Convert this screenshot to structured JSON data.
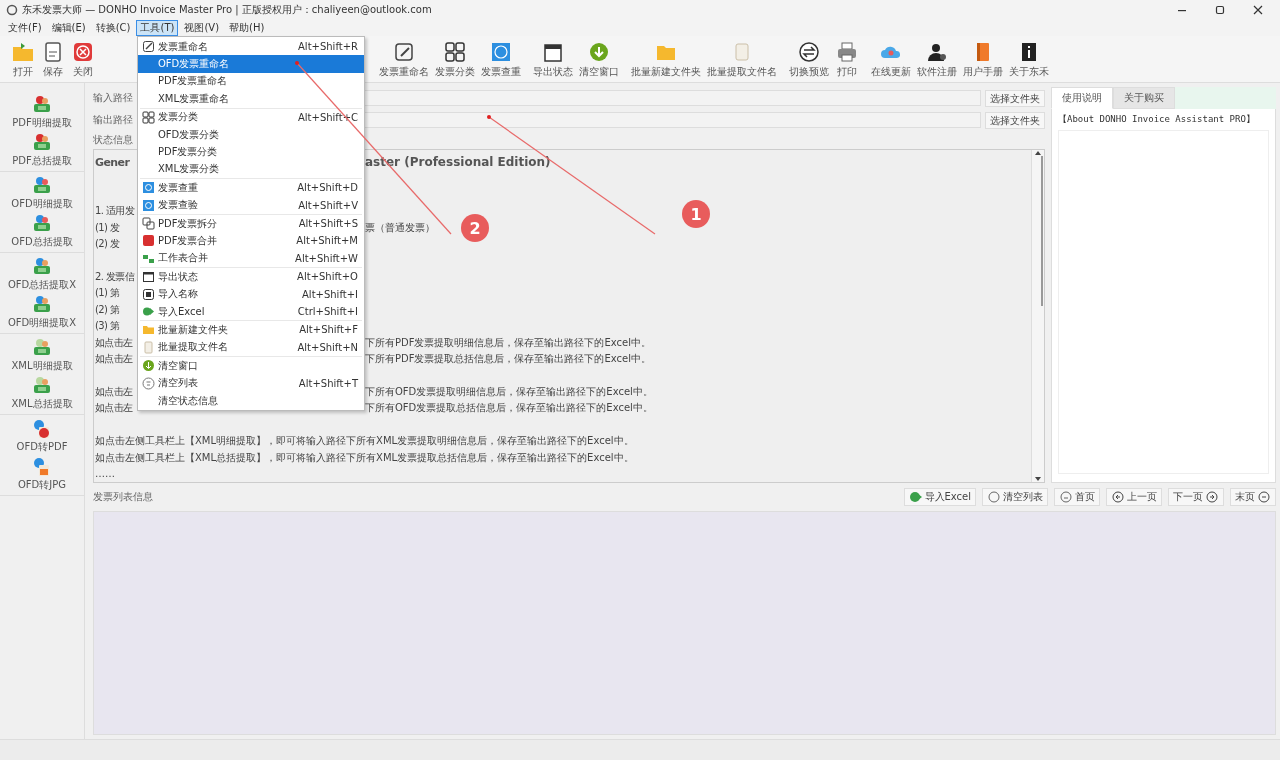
{
  "window": {
    "title": "东禾发票大师 — DONHO Invoice Master Pro  |  正版授权用户：chaliyeen@outlook.com"
  },
  "menu_bar": [
    {
      "label": "文件(F)",
      "selected": false
    },
    {
      "label": "编辑(E)",
      "selected": false
    },
    {
      "label": "转换(C)",
      "selected": false
    },
    {
      "label": "工具(T)",
      "selected": true
    },
    {
      "label": "视图(V)",
      "selected": false
    },
    {
      "label": "帮助(H)",
      "selected": false
    }
  ],
  "toolbar": {
    "groups": [
      [
        "打开",
        "保存",
        "关闭"
      ],
      [
        "发票重命名",
        "发票分类",
        "发票查重"
      ],
      [
        "导出状态",
        "清空窗口"
      ],
      [
        "批量新建文件夹",
        "批量提取文件名"
      ],
      [
        "切换预览",
        "打印"
      ],
      [
        "在线更新",
        "软件注册",
        "用户手册",
        "关于东禾"
      ]
    ]
  },
  "tools_menu": {
    "sections": [
      [
        {
          "label": "发票重命名",
          "shortcut": "Alt+Shift+R",
          "selected": false
        },
        {
          "label": "OFD发票重命名",
          "selected": true
        },
        {
          "label": "PDF发票重命名",
          "selected": false
        },
        {
          "label": "XML发票重命名",
          "selected": false
        }
      ],
      [
        {
          "label": "发票分类",
          "shortcut": "Alt+Shift+C",
          "selected": false
        },
        {
          "label": "OFD发票分类",
          "selected": false
        },
        {
          "label": "PDF发票分类",
          "selected": false
        },
        {
          "label": "XML发票分类",
          "selected": false
        }
      ],
      [
        {
          "label": "发票查重",
          "shortcut": "Alt+Shift+D",
          "selected": false
        },
        {
          "label": "发票查验",
          "shortcut": "Alt+Shift+V",
          "selected": false
        }
      ],
      [
        {
          "label": "PDF发票拆分",
          "shortcut": "Alt+Shift+S",
          "selected": false
        },
        {
          "label": "PDF发票合并",
          "shortcut": "Alt+Shift+M",
          "selected": false
        },
        {
          "label": "工作表合并",
          "shortcut": "Alt+Shift+W",
          "selected": false
        }
      ],
      [
        {
          "label": "导出状态",
          "shortcut": "Alt+Shift+O",
          "selected": false
        },
        {
          "label": "导入名称",
          "shortcut": "Alt+Shift+I",
          "selected": false
        },
        {
          "label": "导入Excel",
          "shortcut": "Ctrl+Shift+I",
          "selected": false
        }
      ],
      [
        {
          "label": "批量新建文件夹",
          "shortcut": "Alt+Shift+F",
          "selected": false
        },
        {
          "label": "批量提取文件名",
          "shortcut": "Alt+Shift+N",
          "selected": false
        }
      ],
      [
        {
          "label": "清空窗口",
          "selected": false
        },
        {
          "label": "清空列表",
          "shortcut": "Alt+Shift+T",
          "selected": false
        },
        {
          "label": "清空状态信息",
          "selected": false
        }
      ]
    ]
  },
  "sidebar": {
    "groups": [
      [
        "PDF明细提取",
        "PDF总括提取"
      ],
      [
        "OFD明细提取",
        "OFD总括提取"
      ],
      [
        "OFD总括提取X",
        "OFD明细提取X"
      ],
      [
        "XML明细提取",
        "XML总括提取"
      ],
      [
        "OFD转PDF",
        "OFD转JPG"
      ]
    ]
  },
  "paths": [
    {
      "label": "输入路径",
      "button": "选择文件夹"
    },
    {
      "label": "输出路径",
      "button": "选择文件夹"
    }
  ],
  "status_label": "状态信息",
  "status_text": [
    {
      "kind": "heading",
      "left": "Gener",
      "right": "aster (Professional Edition)"
    },
    {
      "kind": "blank"
    },
    {
      "kind": "blank"
    },
    {
      "kind": "split",
      "left": "1. 适用发"
    },
    {
      "kind": "split",
      "left": "(1) 发",
      "right": "票（普通发票）"
    },
    {
      "kind": "split",
      "left": "(2) 发"
    },
    {
      "kind": "blank"
    },
    {
      "kind": "split",
      "left": "2. 发票信"
    },
    {
      "kind": "split",
      "left": "(1) 第"
    },
    {
      "kind": "split",
      "left": "(2) 第"
    },
    {
      "kind": "split",
      "left": "(3) 第"
    },
    {
      "kind": "split",
      "left": "如点击左",
      "right": "下所有PDF发票提取明细信息后，保存至输出路径下的Excel中。"
    },
    {
      "kind": "split",
      "left": "如点击左",
      "right": "下所有PDF发票提取总括信息后，保存至输出路径下的Excel中。"
    },
    {
      "kind": "blank"
    },
    {
      "kind": "split",
      "left": "如点击左",
      "right": "下所有OFD发票提取明细信息后，保存至输出路径下的Excel中。"
    },
    {
      "kind": "split",
      "left": "如点击左",
      "right": "下所有OFD发票提取总括信息后，保存至输出路径下的Excel中。"
    },
    {
      "kind": "blank"
    },
    {
      "kind": "full",
      "text": "如点击左侧工具栏上【XML明细提取】，即可将输入路径下所有XML发票提取明细信息后，保存至输出路径下的Excel中。"
    },
    {
      "kind": "full",
      "text": "如点击左侧工具栏上【XML总括提取】，即可将输入路径下所有XML发票提取总括信息后，保存至输出路径下的Excel中。"
    },
    {
      "kind": "full",
      "text": "……"
    }
  ],
  "side_tabs": [
    {
      "label": "使用说明",
      "selected": true
    },
    {
      "label": "关于购买",
      "selected": false
    }
  ],
  "about_text": "【About DONHO Invoice Assistant PRO】",
  "list": {
    "title": "发票列表信息",
    "buttons": [
      "导入Excel",
      "清空列表",
      "首页",
      "上一页",
      "下一页",
      "末页"
    ]
  },
  "annotations": [
    {
      "label": "1"
    },
    {
      "label": "2"
    }
  ]
}
